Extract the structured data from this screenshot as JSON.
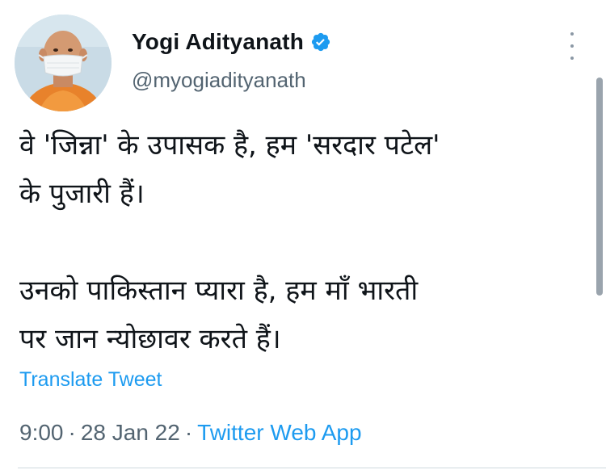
{
  "author": {
    "display_name": "Yogi Adityanath",
    "handle": "@myogiadityanath",
    "verified": true,
    "avatar_icon": "profile-photo"
  },
  "tweet": {
    "lines": [
      "वे 'जिन्ना' के उपासक है, हम 'सरदार पटेल'",
      "के पुजारी हैं।",
      "उनको पाकिस्तान प्यारा है, हम माँ भारती",
      "पर जान न्योछावर करते हैं।"
    ],
    "translate_label": "Translate Tweet",
    "time": "9:00",
    "date": "28 Jan 22",
    "separator": "·",
    "source": "Twitter Web App"
  },
  "colors": {
    "accent": "#1d9bf0",
    "secondary_text": "#536471",
    "primary_text": "#0f1419"
  }
}
